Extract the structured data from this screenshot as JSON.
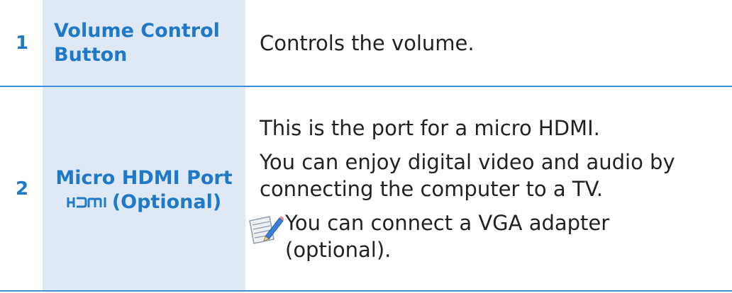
{
  "rows": [
    {
      "number": "1",
      "term_line1": "Volume Control",
      "term_line2": "Button",
      "description": "Controls the volume."
    },
    {
      "number": "2",
      "term_line1": "Micro HDMI Port",
      "term_logo": "HDMI",
      "term_suffix": "(Optional)",
      "description_para1": "This is the port for a micro HDMI.",
      "description_para2_line1": "You can enjoy digital video and audio by",
      "description_para2_line2": "connecting the computer to a TV.",
      "note_line1": "You can connect a VGA adapter",
      "note_line2": "(optional).",
      "note_icon": "note-pencil-icon"
    }
  ],
  "colors": {
    "accent": "#1f79c6",
    "term_background": "#dfe9f5",
    "rule": "#3f8ed8",
    "text": "#222222"
  }
}
